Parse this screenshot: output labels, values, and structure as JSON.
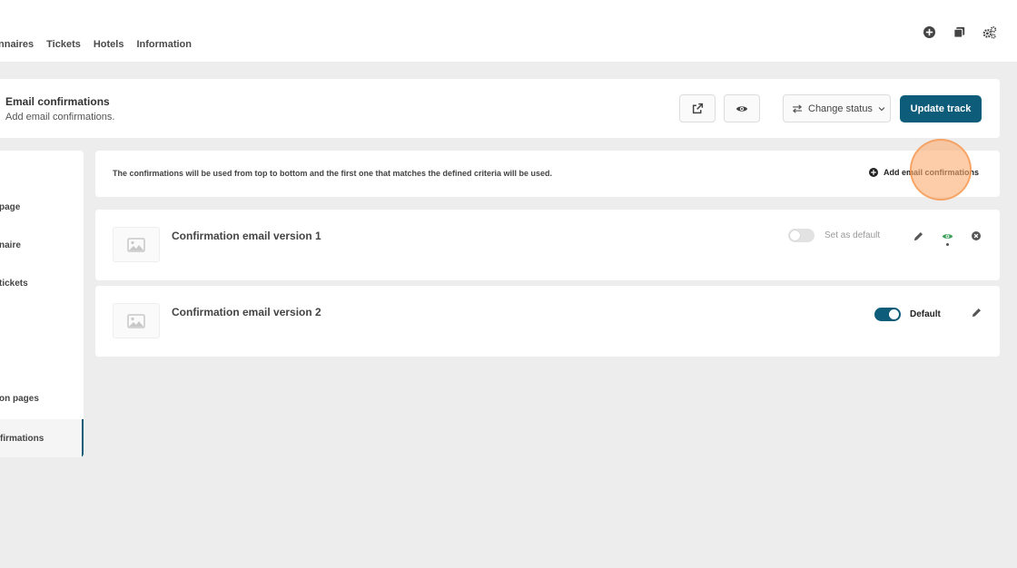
{
  "nav": {
    "items": [
      "nnaires",
      "Tickets",
      "Hotels",
      "Information"
    ]
  },
  "top_icons": [
    "plus-circle-icon",
    "copy-icon",
    "cogs-icon"
  ],
  "header": {
    "title": "Email confirmations",
    "subtitle": "Add email confirmations.",
    "change_status_label": "Change status",
    "update_label": "Update track"
  },
  "sidebar": {
    "items": [
      " page",
      "naire",
      "tickets",
      "on pages"
    ],
    "active_item": "firmations"
  },
  "info": {
    "text": "The confirmations will be used from top to bottom and the first one that matches the defined criteria will be used.",
    "add_label": "Add email confirmations"
  },
  "emails": [
    {
      "name": "Confirmation email version 1",
      "toggle_label": "Set as default",
      "is_default": false
    },
    {
      "name": "Confirmation email version 2",
      "toggle_label": "Default",
      "is_default": true
    }
  ],
  "colors": {
    "accent": "#0d5c7a",
    "preview_active": "#3aa05a",
    "background": "#ededed"
  }
}
